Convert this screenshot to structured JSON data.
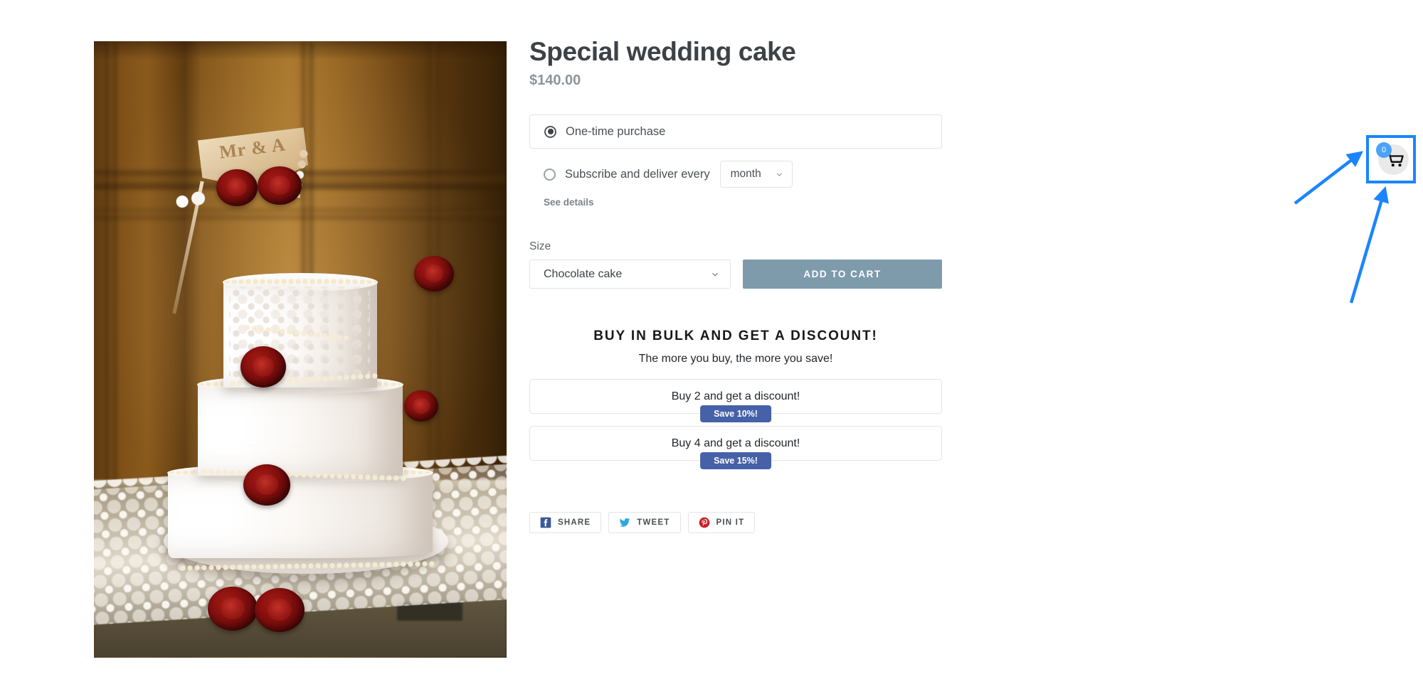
{
  "product": {
    "title": "Special wedding cake",
    "price": "$140.00",
    "image_alt": "Three-tier white wedding cake with red roses and a Mr & Mrs topper",
    "topper_text": "Mr & A"
  },
  "purchase_options": {
    "one_time": {
      "label": "One-time purchase",
      "selected": true
    },
    "subscription": {
      "label": "Subscribe and deliver every",
      "selected": false,
      "interval_value": "month",
      "interval_options": [
        "month"
      ],
      "see_details_label": "See details"
    }
  },
  "variant": {
    "label": "Size",
    "value": "Chocolate cake",
    "options": [
      "Chocolate cake"
    ]
  },
  "actions": {
    "add_to_cart": "ADD TO CART"
  },
  "bulk": {
    "title": "BUY IN BULK AND GET A DISCOUNT!",
    "subtitle": "The more you buy, the more you save!",
    "offers": [
      {
        "label": "Buy 2 and get a discount!",
        "badge": "Save 10%!"
      },
      {
        "label": "Buy 4 and get a discount!",
        "badge": "Save 15%!"
      }
    ],
    "badge_color": "#4661a8"
  },
  "share": [
    {
      "label": "SHARE",
      "icon": "facebook-icon",
      "color": "#3b5998"
    },
    {
      "label": "TWEET",
      "icon": "twitter-icon",
      "color": "#2ca9e1"
    },
    {
      "label": "PIN IT",
      "icon": "pinterest-icon",
      "color": "#cb2027"
    }
  ],
  "cart": {
    "icon": "shopping-cart-icon",
    "count": "0",
    "badge_color": "#4aa3f7"
  },
  "annotation": {
    "highlight_color": "#1a85ff",
    "arrow_count": 2,
    "target": "cart-widget"
  },
  "theme": {
    "accent_button": "#7e9bac",
    "price_color": "#8d9499",
    "text_color": "#3d4246"
  }
}
